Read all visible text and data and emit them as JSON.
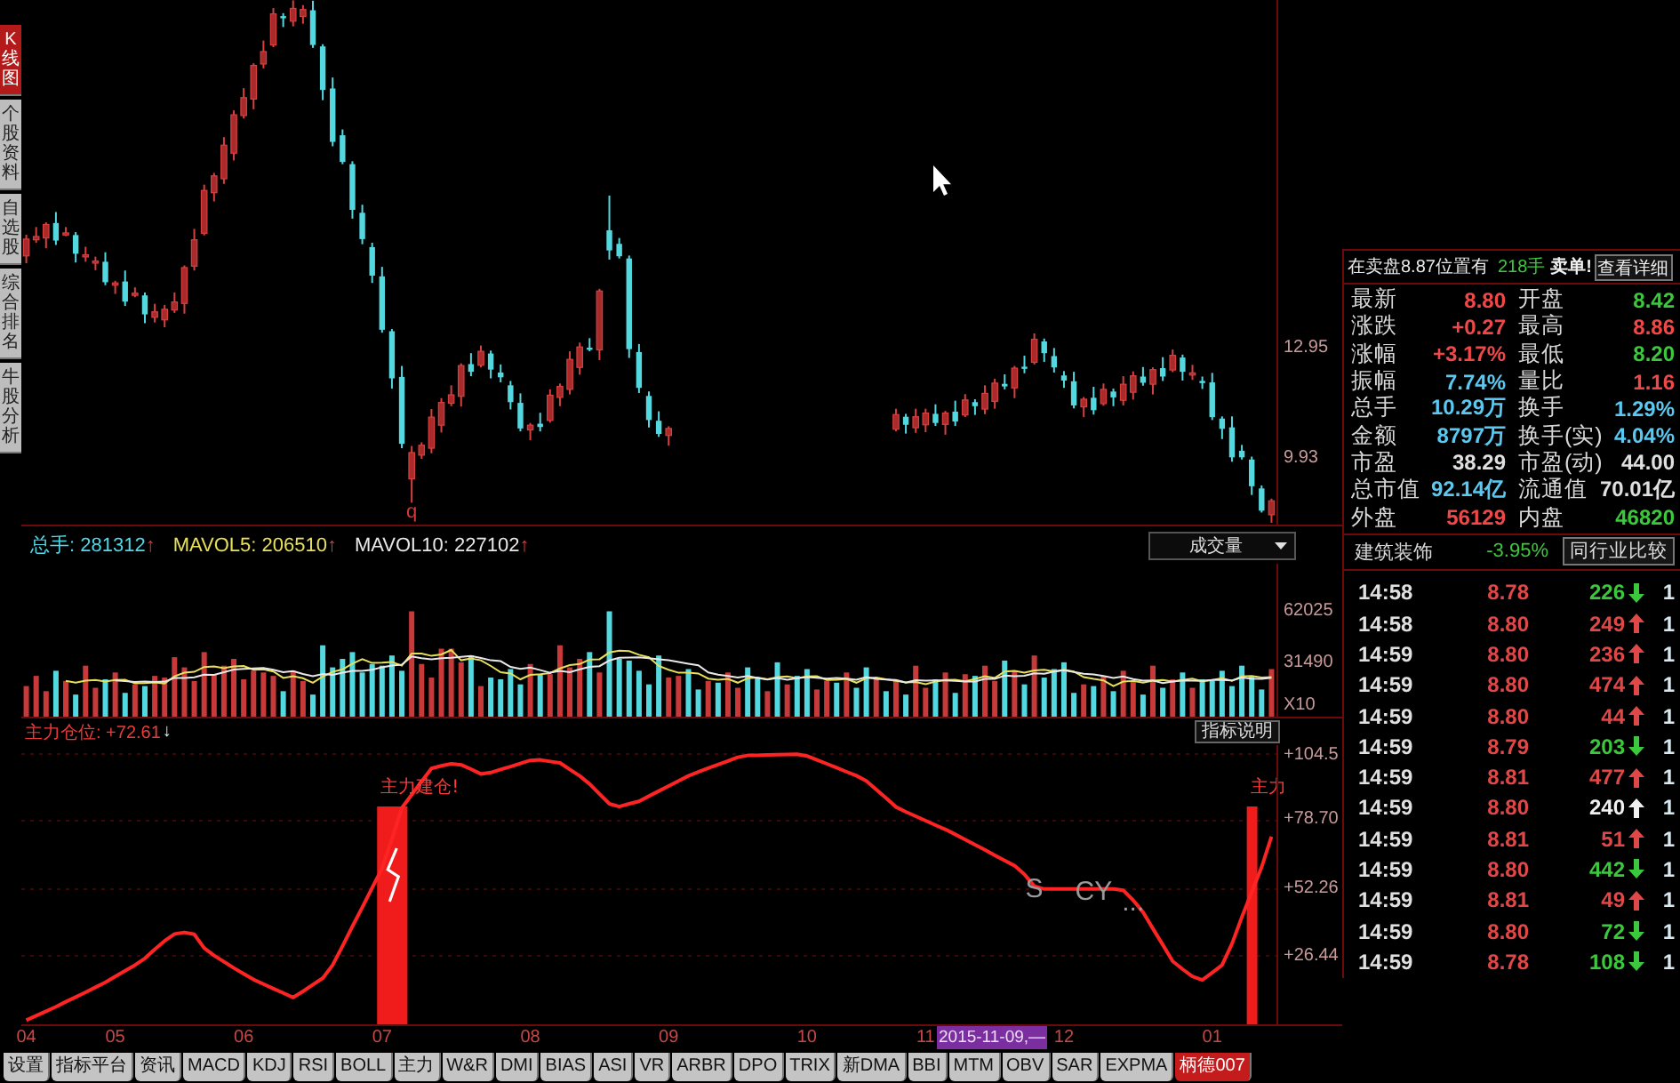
{
  "side_tabs": [
    {
      "label": "K线图",
      "selected": true
    },
    {
      "label": "个股资料",
      "selected": false
    },
    {
      "label": "自选股",
      "selected": false
    },
    {
      "label": "综合排名",
      "selected": false
    },
    {
      "label": "牛股分析",
      "selected": false
    }
  ],
  "price_chart": {
    "chart_data": {
      "type": "candlestick",
      "ylim": [
        8.15,
        22.5
      ],
      "yticks": [
        {
          "value": 12.95,
          "label": "12.95"
        },
        {
          "value": 9.93,
          "label": "9.93"
        }
      ],
      "annotations": [
        "q"
      ],
      "ohlc": [
        [
          15.5,
          16.08,
          15.3,
          15.96
        ],
        [
          15.94,
          16.29,
          15.86,
          16.03
        ],
        [
          15.99,
          16.42,
          15.71,
          16.36
        ],
        [
          16.4,
          16.7,
          15.8,
          15.92
        ],
        [
          16.1,
          16.29,
          16.04,
          16.13
        ],
        [
          16.07,
          16.15,
          15.32,
          15.56
        ],
        [
          15.48,
          15.75,
          15.34,
          15.53
        ],
        [
          15.31,
          15.48,
          15.11,
          15.36
        ],
        [
          15.34,
          15.6,
          14.7,
          14.78
        ],
        [
          14.74,
          14.82,
          14.46,
          14.76
        ],
        [
          14.8,
          15.1,
          14.13,
          14.25
        ],
        [
          14.43,
          14.64,
          14.37,
          14.48
        ],
        [
          14.42,
          14.5,
          13.66,
          13.9
        ],
        [
          13.82,
          14.19,
          13.68,
          13.97
        ],
        [
          13.75,
          14.16,
          13.55,
          14.04
        ],
        [
          14.02,
          14.5,
          13.94,
          14.24
        ],
        [
          14.2,
          15.24,
          13.92,
          15.18
        ],
        [
          15.22,
          16.24,
          15.1,
          15.94
        ],
        [
          16.12,
          17.45,
          16.06,
          17.29
        ],
        [
          17.23,
          17.77,
          16.99,
          17.69
        ],
        [
          17.61,
          18.75,
          17.47,
          18.53
        ],
        [
          18.31,
          19.48,
          18.11,
          19.36
        ],
        [
          19.34,
          20.09,
          19.26,
          19.83
        ],
        [
          19.79,
          20.77,
          19.51,
          20.71
        ],
        [
          20.75,
          21.39,
          20.63,
          21.09
        ],
        [
          21.27,
          22.28,
          21.21,
          22.12
        ],
        [
          22.06,
          22.14,
          21.76,
          22.0
        ],
        [
          21.92,
          22.49,
          21.78,
          22.27
        ],
        [
          22.05,
          22.36,
          21.85,
          22.24
        ],
        [
          22.22,
          22.48,
          21.19,
          21.27
        ],
        [
          21.23,
          21.29,
          19.76,
          20.04
        ],
        [
          20.08,
          20.38,
          18.5,
          18.62
        ],
        [
          18.8,
          18.96,
          18.01,
          18.07
        ],
        [
          18.01,
          18.09,
          16.52,
          16.76
        ],
        [
          16.68,
          16.9,
          15.82,
          15.96
        ],
        [
          15.74,
          15.86,
          14.76,
          14.96
        ],
        [
          14.94,
          15.2,
          13.4,
          13.48
        ],
        [
          13.44,
          13.5,
          11.87,
          12.15
        ],
        [
          12.19,
          12.49,
          10.24,
          10.36
        ],
        [
          9.4,
          10.3,
          8.75,
          10.12
        ],
        [
          10.05,
          10.4,
          9.95,
          10.32
        ],
        [
          10.24,
          11.31,
          10.1,
          11.09
        ],
        [
          10.87,
          11.61,
          10.67,
          11.49
        ],
        [
          11.47,
          11.96,
          11.39,
          11.7
        ],
        [
          11.66,
          12.56,
          11.38,
          12.5
        ],
        [
          12.54,
          12.84,
          12.21,
          12.33
        ],
        [
          12.51,
          13.05,
          12.45,
          12.89
        ],
        [
          12.83,
          12.91,
          12.15,
          12.39
        ],
        [
          12.31,
          12.53,
          12.04,
          12.18
        ],
        [
          11.96,
          12.08,
          11.3,
          11.5
        ],
        [
          11.48,
          11.74,
          10.7,
          10.78
        ],
        [
          10.74,
          10.93,
          10.46,
          10.87
        ],
        [
          10.91,
          11.21,
          10.7,
          10.82
        ],
        [
          11.0,
          11.85,
          10.94,
          11.69
        ],
        [
          11.63,
          12.01,
          11.39,
          11.93
        ],
        [
          11.85,
          12.89,
          11.71,
          12.67
        ],
        [
          12.45,
          13.13,
          12.25,
          13.01
        ],
        [
          12.99,
          13.25,
          12.89,
          12.97
        ],
        [
          12.93,
          14.6,
          12.65,
          14.54
        ],
        [
          16.2,
          17.15,
          15.4,
          15.65
        ],
        [
          15.83,
          15.99,
          15.43,
          15.49
        ],
        [
          15.43,
          15.51,
          12.71,
          12.95
        ],
        [
          12.87,
          13.09,
          11.75,
          11.89
        ],
        [
          11.67,
          11.79,
          10.81,
          11.01
        ],
        [
          10.99,
          11.25,
          10.55,
          10.63
        ],
        [
          10.59,
          10.84,
          10.31,
          10.78
        ],
        null,
        null,
        null,
        null,
        null,
        null,
        null,
        null,
        null,
        null,
        null,
        null,
        null,
        null,
        null,
        null,
        null,
        null,
        null,
        null,
        null,
        null,
        [
          10.76,
          11.32,
          10.7,
          11.16
        ],
        [
          11.1,
          11.18,
          10.64,
          10.88
        ],
        [
          10.8,
          11.32,
          10.66,
          11.1
        ],
        [
          10.88,
          11.32,
          10.68,
          11.2
        ],
        [
          11.18,
          11.44,
          10.85,
          10.93
        ],
        [
          10.89,
          11.26,
          10.61,
          11.2
        ],
        [
          11.24,
          11.54,
          10.85,
          10.97
        ],
        [
          11.15,
          11.72,
          11.09,
          11.56
        ],
        [
          11.5,
          11.58,
          11.15,
          11.39
        ],
        [
          11.31,
          11.96,
          11.17,
          11.74
        ],
        [
          11.52,
          12.14,
          11.32,
          12.02
        ],
        [
          12.0,
          12.26,
          11.85,
          11.93
        ],
        [
          11.89,
          12.49,
          11.61,
          12.43
        ],
        [
          12.47,
          12.77,
          12.29,
          12.41
        ],
        [
          12.59,
          13.38,
          12.53,
          13.22
        ],
        [
          13.16,
          13.24,
          12.6,
          12.84
        ],
        [
          12.76,
          12.98,
          12.31,
          12.45
        ],
        [
          12.23,
          12.35,
          11.89,
          12.09
        ],
        [
          12.07,
          12.33,
          11.33,
          11.41
        ],
        [
          11.37,
          11.64,
          11.09,
          11.58
        ],
        [
          11.62,
          11.92,
          11.16,
          11.28
        ],
        [
          11.46,
          12.01,
          11.4,
          11.85
        ],
        [
          11.79,
          11.87,
          11.39,
          11.63
        ],
        [
          11.55,
          12.21,
          11.41,
          11.99
        ],
        [
          11.77,
          12.34,
          11.57,
          12.22
        ],
        [
          12.2,
          12.46,
          11.95,
          12.03
        ],
        [
          11.99,
          12.45,
          11.71,
          12.39
        ],
        [
          12.43,
          12.73,
          12.08,
          12.2
        ],
        [
          12.38,
          12.94,
          12.32,
          12.78
        ],
        [
          12.72,
          12.8,
          12.09,
          12.33
        ],
        [
          12.25,
          12.52,
          12.11,
          12.3
        ],
        [
          12.08,
          12.2,
          11.86,
          12.06
        ],
        [
          12.04,
          12.3,
          11.01,
          11.09
        ],
        [
          11.05,
          11.11,
          10.49,
          10.77
        ],
        [
          10.81,
          11.11,
          9.87,
          9.99
        ],
        [
          10.17,
          10.33,
          9.93,
          9.99
        ],
        [
          9.93,
          10.01,
          8.96,
          9.2
        ],
        [
          9.14,
          9.22,
          8.48,
          8.53
        ],
        [
          8.42,
          8.86,
          8.2,
          8.8
        ]
      ]
    }
  },
  "volume": {
    "stats": [
      {
        "label": "总手:",
        "value": "281312",
        "arrow": "↑",
        "color": "#4fd8e8"
      },
      {
        "label": "MAVOL5:",
        "value": "206510",
        "arrow": "↑",
        "color": "#e6e05a"
      },
      {
        "label": "MAVOL10:",
        "value": "227102",
        "arrow": "↑",
        "color": "#e8e8e8"
      }
    ],
    "selector": "成交量",
    "chart_data": {
      "type": "bar",
      "stacked": true,
      "ylim": [
        0,
        90000
      ],
      "yticks": [
        {
          "value": 62025,
          "label": "62025"
        },
        {
          "value": 31490,
          "label": "31490"
        }
      ],
      "ylabel": "X10",
      "series": [
        {
          "color": "#c83a3a",
          "values": [
            18000,
            24000,
            15000,
            null,
            21000,
            null,
            30000,
            17000,
            null,
            26000,
            null,
            19000,
            null,
            24000,
            23000,
            35000,
            29000,
            21000,
            38000,
            25000,
            30000,
            34000,
            22000,
            27000,
            26000,
            24000,
            null,
            27000,
            21000,
            null,
            null,
            null,
            null,
            null,
            null,
            null,
            null,
            null,
            null,
            62000,
            31000,
            23000,
            40000,
            40000,
            32000,
            null,
            18000,
            null,
            null,
            null,
            null,
            31000,
            null,
            25000,
            42000,
            29000,
            34000,
            null,
            26000,
            null,
            null,
            null,
            null,
            null,
            null,
            23000,
            24000,
            null,
            null,
            21000,
            null,
            26000,
            17000,
            null,
            null,
            15000,
            null,
            19000,
            null,
            null,
            16000,
            21000,
            null,
            26000,
            null,
            null,
            23000,
            null,
            21000,
            null,
            30000,
            17000,
            null,
            26000,
            null,
            25000,
            null,
            30000,
            21000,
            null,
            27000,
            null,
            36000,
            null,
            null,
            null,
            null,
            19000,
            null,
            24000,
            null,
            27000,
            21000,
            null,
            30000,
            null,
            22000,
            null,
            17000,
            null,
            null,
            null,
            null,
            null,
            null,
            null,
            28000
          ]
        },
        {
          "color": "#54d8e0",
          "values": [
            null,
            null,
            null,
            27000,
            null,
            13000,
            null,
            null,
            22000,
            null,
            14000,
            null,
            18000,
            null,
            null,
            null,
            null,
            null,
            null,
            null,
            null,
            null,
            null,
            null,
            null,
            null,
            15000,
            null,
            null,
            13000,
            42000,
            29000,
            34000,
            38000,
            26000,
            31000,
            30000,
            36000,
            27000,
            null,
            null,
            null,
            null,
            null,
            null,
            36000,
            null,
            23000,
            22000,
            28000,
            19000,
            null,
            25000,
            null,
            null,
            null,
            null,
            38000,
            null,
            62000,
            34000,
            33000,
            27000,
            19000,
            36000,
            null,
            null,
            28000,
            16000,
            null,
            20000,
            null,
            null,
            29000,
            23000,
            null,
            32000,
            null,
            24000,
            28000,
            null,
            null,
            20000,
            null,
            17000,
            29000,
            null,
            15000,
            null,
            13000,
            null,
            null,
            22000,
            null,
            14000,
            null,
            24000,
            null,
            null,
            33000,
            null,
            19000,
            null,
            23000,
            28000,
            32000,
            14000,
            null,
            18000,
            null,
            15000,
            null,
            null,
            13000,
            null,
            17000,
            null,
            26000,
            null,
            22000,
            21000,
            27000,
            18000,
            30000,
            24000,
            16000,
            null
          ]
        },
        {
          "type": "line",
          "color": "#e6e05a",
          "values": [
            null,
            null,
            null,
            null,
            21000,
            20000,
            21200,
            21600,
            20600,
            21600,
            21800,
            19600,
            19800,
            20200,
            19600,
            23800,
            25800,
            26400,
            29200,
            29600,
            28600,
            29600,
            29800,
            27600,
            27800,
            26600,
            22800,
            23800,
            22600,
            20000,
            23600,
            26400,
            27800,
            31200,
            33800,
            31600,
            31800,
            32200,
            30000,
            37200,
            37200,
            35800,
            36600,
            39200,
            33200,
            34200,
            33200,
            29800,
            26200,
            25400,
            22000,
            24600,
            25000,
            25600,
            28400,
            30400,
            31000,
            33600,
            33800,
            37800,
            38800,
            38600,
            36400,
            35000,
            29800,
            27600,
            25800,
            26000,
            25400,
            22400,
            21800,
            22200,
            20000,
            22600,
            23000,
            22000,
            23200,
            23600,
            22600,
            23600,
            23800,
            21600,
            21800,
            22200,
            20000,
            22600,
            23000,
            22000,
            21000,
            20200,
            20400,
            19200,
            20600,
            21600,
            21800,
            20800,
            22200,
            23800,
            22800,
            26600,
            27000,
            26000,
            27200,
            27600,
            26600,
            27600,
            26600,
            23200,
            22200,
            21400,
            18000,
            20600,
            21000,
            20000,
            21200,
            21600,
            20600,
            21600,
            22400,
            20800,
            21600,
            22600,
            21000,
            23600,
            24000,
            23000,
            23200
          ]
        },
        {
          "type": "line",
          "color": "#e8e8e8",
          "values": [
            null,
            null,
            null,
            null,
            null,
            null,
            null,
            null,
            null,
            21300,
            20900,
            20400,
            20700,
            20400,
            20600,
            22800,
            22700,
            23100,
            24700,
            24600,
            26200,
            27700,
            28100,
            28400,
            28700,
            27600,
            26200,
            26800,
            25100,
            23900,
            25100,
            24600,
            25800,
            26900,
            26900,
            27600,
            29100,
            30000,
            30600,
            35500,
            34400,
            33800,
            34400,
            34600,
            35200,
            35700,
            34500,
            33200,
            32700,
            29300,
            28100,
            28900,
            27400,
            25900,
            26900,
            26200,
            27800,
            29300,
            29700,
            33100,
            34600,
            34800,
            35000,
            34400,
            33800,
            33200,
            32200,
            31200,
            30200,
            26100,
            24700,
            24000,
            23000,
            24000,
            22700,
            21900,
            22700,
            21800,
            22600,
            23300,
            22900,
            22400,
            22700,
            22400,
            21800,
            23200,
            22300,
            21900,
            21600,
            20100,
            21500,
            21100,
            21300,
            21300,
            21000,
            20600,
            20700,
            22200,
            22200,
            24200,
            23900,
            24100,
            25500,
            25200,
            26600,
            27300,
            26300,
            25200,
            24900,
            24000,
            22800,
            23600,
            22100,
            21100,
            21300,
            19800,
            20600,
            21300,
            21200,
            21000,
            21600,
            21600,
            21300,
            23000,
            22400,
            22300,
            22900
          ]
        }
      ]
    }
  },
  "indicator": {
    "label": "主力仓位:",
    "value": "+72.61",
    "arrow": "↓",
    "help_button": "指标说明",
    "chart_data": {
      "type": "line",
      "grid": true,
      "categories": [
        "04",
        null,
        null,
        null,
        null,
        null,
        null,
        null,
        null,
        "05",
        null,
        null,
        null,
        null,
        null,
        null,
        null,
        null,
        null,
        null,
        null,
        null,
        "06",
        null,
        null,
        null,
        null,
        null,
        null,
        null,
        null,
        null,
        null,
        null,
        null,
        null,
        "07",
        null,
        null,
        null,
        null,
        null,
        null,
        null,
        null,
        null,
        null,
        null,
        null,
        null,
        null,
        "08",
        null,
        null,
        null,
        null,
        null,
        null,
        null,
        null,
        null,
        null,
        null,
        null,
        null,
        "09",
        null,
        null,
        null,
        null,
        null,
        null,
        null,
        null,
        null,
        null,
        null,
        null,
        null,
        "10",
        null,
        null,
        null,
        null,
        null,
        null,
        null,
        null,
        null,
        null,
        null,
        "11",
        null,
        null,
        null,
        null,
        null,
        null,
        null,
        null,
        null,
        null,
        null,
        null,
        null,
        "12",
        null,
        null,
        null,
        null,
        null,
        null,
        null,
        null,
        null,
        null,
        null,
        null,
        null,
        null,
        "01",
        null,
        null,
        null,
        null,
        null,
        null
      ],
      "ylim": [
        0,
        107.9
      ],
      "yticks": [
        {
          "value": 104.5,
          "label": "+104.5"
        },
        {
          "value": 78.7,
          "label": "+78.70"
        },
        {
          "value": 52.26,
          "label": "+52.26"
        },
        {
          "value": 26.44,
          "label": "+26.44"
        }
      ],
      "series": [
        {
          "color": "#ff2424",
          "values": [
            1.6,
            3.3,
            5.0,
            6.8,
            8.7,
            10.5,
            12.4,
            14.3,
            16.2,
            18.5,
            20.7,
            22.9,
            25.5,
            28.9,
            32.2,
            34.9,
            35.5,
            34.8,
            29.5,
            26.6,
            24.2,
            21.8,
            19.5,
            17.3,
            15.5,
            13.8,
            12.1,
            10.4,
            12.7,
            15.3,
            17.9,
            22.9,
            30.3,
            37.8,
            45.2,
            52.7,
            60.3,
            71.6,
            83.6,
            88.7,
            93.8,
            98.9,
            99.9,
            100.7,
            100.3,
            98.6,
            96.8,
            97.3,
            98.5,
            99.6,
            100.8,
            102.0,
            102.2,
            101.6,
            101.0,
            98.5,
            96.0,
            92.9,
            89.1,
            85.2,
            84.1,
            85.2,
            86.2,
            88.2,
            90.2,
            92.1,
            94.1,
            96.0,
            97.5,
            99.0,
            100.4,
            101.8,
            103.2,
            103.9,
            104.0,
            104.1,
            104.2,
            104.3,
            104.4,
            103.7,
            102.2,
            100.7,
            99.2,
            97.6,
            96.1,
            94.1,
            90.7,
            87.4,
            84.0,
            82.1,
            80.4,
            78.7,
            77.0,
            75.3,
            73.4,
            71.4,
            69.4,
            67.4,
            65.3,
            63.3,
            61.3,
            58.0,
            53.4,
            52.3,
            52.3,
            52.3,
            52.3,
            52.3,
            52.3,
            52.3,
            52.3,
            51.8,
            48.0,
            43.3,
            37.0,
            30.7,
            24.4,
            21.3,
            18.5,
            17.1,
            20.0,
            22.9,
            31.1,
            41.4,
            51.1,
            60.8,
            72.6
          ]
        },
        {
          "type": "bar",
          "color": "#f01c1c",
          "values": [
            null,
            null,
            null,
            null,
            null,
            null,
            null,
            null,
            null,
            null,
            null,
            null,
            null,
            null,
            null,
            null,
            null,
            null,
            null,
            null,
            null,
            null,
            null,
            null,
            null,
            null,
            null,
            null,
            null,
            null,
            null,
            null,
            null,
            null,
            null,
            null,
            84.2,
            84.2,
            84.2,
            null,
            null,
            null,
            null,
            null,
            null,
            null,
            null,
            null,
            null,
            null,
            null,
            null,
            null,
            null,
            null,
            null,
            null,
            null,
            null,
            null,
            null,
            null,
            null,
            null,
            null,
            null,
            null,
            null,
            null,
            null,
            null,
            null,
            null,
            null,
            null,
            null,
            null,
            null,
            null,
            null,
            null,
            null,
            null,
            null,
            null,
            null,
            null,
            null,
            null,
            null,
            null,
            null,
            null,
            null,
            null,
            null,
            null,
            null,
            null,
            null,
            null,
            null,
            null,
            null,
            null,
            null,
            null,
            null,
            null,
            null,
            null,
            null,
            null,
            null,
            null,
            null,
            null,
            null,
            null,
            null,
            null,
            null,
            null,
            null,
            84.2,
            null,
            null
          ]
        }
      ],
      "annotations": [
        "主力建仓!",
        "主力",
        "S",
        "CY",
        "..."
      ]
    }
  },
  "cursor_date": "2015-11-09,—",
  "quote_header": {
    "text": "在卖盘8.87位置有",
    "volume": "218手",
    "suffix": "卖单!",
    "button": "查看详细"
  },
  "quote": [
    {
      "label": "最新",
      "value": "8.80",
      "color": "#f04848"
    },
    {
      "label": "开盘",
      "value": "8.42",
      "color": "#3cc83c"
    },
    {
      "label": "涨跌",
      "value": "+0.27",
      "color": "#f04848"
    },
    {
      "label": "最高",
      "value": "8.86",
      "color": "#f04848"
    },
    {
      "label": "涨幅",
      "value": "+3.17%",
      "color": "#f04848"
    },
    {
      "label": "最低",
      "value": "8.20",
      "color": "#3cc83c"
    },
    {
      "label": "振幅",
      "value": "7.74%",
      "color": "#5ac8f0"
    },
    {
      "label": "量比",
      "value": "1.16",
      "color": "#f04848"
    },
    {
      "label": "总手",
      "value": "10.29万",
      "color": "#5ac8f0"
    },
    {
      "label": "换手",
      "value": "1.29%",
      "color": "#5ac8f0"
    },
    {
      "label": "金额",
      "value": "8797万",
      "color": "#5ac8f0"
    },
    {
      "label": "换手(实)",
      "value": "4.04%",
      "color": "#5ac8f0"
    },
    {
      "label": "市盈",
      "value": "38.29",
      "color": "#e0e0e0"
    },
    {
      "label": "市盈(动)",
      "value": "44.00",
      "color": "#e0e0e0"
    },
    {
      "label": "总市值",
      "value": "92.14亿",
      "color": "#5ac8f0"
    },
    {
      "label": "流通值",
      "value": "70.01亿",
      "color": "#e0e0e0"
    },
    {
      "label": "外盘",
      "value": "56129",
      "color": "#f04848"
    },
    {
      "label": "内盘",
      "value": "46820",
      "color": "#3cc83c"
    }
  ],
  "industry": {
    "name": "建筑装饰",
    "change": "-3.95%",
    "button": "同行业比较"
  },
  "ticks": [
    {
      "time": "14:58",
      "price": "8.78",
      "volume": "226",
      "rising": false,
      "color": "#3cc83c",
      "column_5": "1"
    },
    {
      "time": "14:58",
      "price": "8.80",
      "volume": "249",
      "rising": true,
      "color": "#e04848",
      "column_5": "1"
    },
    {
      "time": "14:59",
      "price": "8.80",
      "volume": "236",
      "rising": true,
      "color": "#e04848",
      "column_5": "1"
    },
    {
      "time": "14:59",
      "price": "8.80",
      "volume": "474",
      "rising": true,
      "color": "#e04848",
      "column_5": "1"
    },
    {
      "time": "14:59",
      "price": "8.80",
      "volume": "44",
      "rising": true,
      "color": "#e04848",
      "column_5": "1"
    },
    {
      "time": "14:59",
      "price": "8.79",
      "volume": "203",
      "rising": false,
      "color": "#3cc83c",
      "column_5": "1"
    },
    {
      "time": "14:59",
      "price": "8.81",
      "volume": "477",
      "rising": true,
      "color": "#e04848",
      "column_5": "1"
    },
    {
      "time": "14:59",
      "price": "8.80",
      "volume": "240",
      "rising": true,
      "color": "#f0f0f0",
      "column_5": "1"
    },
    {
      "time": "14:59",
      "price": "8.81",
      "volume": "51",
      "rising": true,
      "color": "#e04848",
      "column_5": "1"
    },
    {
      "time": "14:59",
      "price": "8.80",
      "volume": "442",
      "rising": false,
      "color": "#3cc83c",
      "column_5": "1"
    },
    {
      "time": "14:59",
      "price": "8.81",
      "volume": "49",
      "rising": true,
      "color": "#e04848",
      "column_5": "1"
    },
    {
      "time": "14:59",
      "price": "8.80",
      "volume": "72",
      "rising": false,
      "color": "#3cc83c",
      "column_5": "1"
    },
    {
      "time": "14:59",
      "price": "8.78",
      "volume": "108",
      "rising": false,
      "color": "#3cc83c",
      "column_5": "1"
    }
  ],
  "bottom_tabs": [
    {
      "label": "设置",
      "selected": false
    },
    {
      "label": "指标平台",
      "selected": false
    },
    {
      "label": "资讯",
      "selected": false
    },
    {
      "label": "MACD",
      "selected": false
    },
    {
      "label": "KDJ",
      "selected": false
    },
    {
      "label": "RSI",
      "selected": false
    },
    {
      "label": "BOLL",
      "selected": false
    },
    {
      "label": "主力",
      "selected": false
    },
    {
      "label": "W&R",
      "selected": false
    },
    {
      "label": "DMI",
      "selected": false
    },
    {
      "label": "BIAS",
      "selected": false
    },
    {
      "label": "ASI",
      "selected": false
    },
    {
      "label": "VR",
      "selected": false
    },
    {
      "label": "ARBR",
      "selected": false
    },
    {
      "label": "DPO",
      "selected": false
    },
    {
      "label": "TRIX",
      "selected": false
    },
    {
      "label": "新DMA",
      "selected": false
    },
    {
      "label": "BBI",
      "selected": false
    },
    {
      "label": "MTM",
      "selected": false
    },
    {
      "label": "OBV",
      "selected": false
    },
    {
      "label": "SAR",
      "selected": false
    },
    {
      "label": "EXPMA",
      "selected": false
    },
    {
      "label": "柄德007",
      "selected": true
    }
  ]
}
